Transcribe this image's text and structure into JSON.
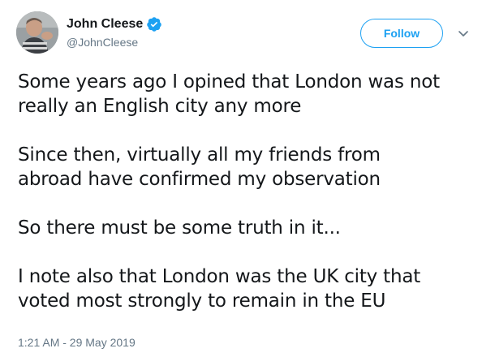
{
  "author": {
    "display_name": "John Cleese",
    "handle": "@JohnCleese",
    "verified": true,
    "avatar_icon": "profile-photo"
  },
  "actions": {
    "follow_label": "Follow",
    "more_icon": "chevron-down-icon"
  },
  "tweet": {
    "paragraphs": [
      "Some years ago I opined that London was not\nreally an English city any more",
      "Since then, virtually all my friends from\nabroad have confirmed my observation",
      "So there must be some truth in it...",
      "I note also that London was the UK city that\nvoted most strongly to remain in the EU"
    ],
    "timestamp": "1:21 AM - 29 May 2019"
  },
  "colors": {
    "accent": "#1da1f2",
    "secondary_text": "#657786",
    "primary_text": "#14171a"
  }
}
